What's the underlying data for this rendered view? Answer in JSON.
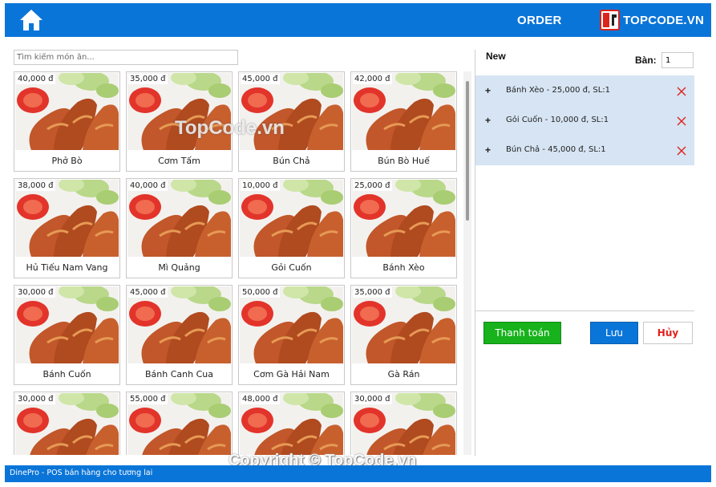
{
  "header": {
    "title": "ORDER",
    "logo_text": "TOPCODE.VN",
    "colors": {
      "bar": "#0a75d8",
      "logo_accent": "#d9251c"
    }
  },
  "search": {
    "placeholder": "Tìm kiếm món ăn..."
  },
  "menu": {
    "items": [
      {
        "name": "Phở Bò",
        "price": "40,000 đ"
      },
      {
        "name": "Cơm Tấm",
        "price": "35,000 đ"
      },
      {
        "name": "Bún Chả",
        "price": "45,000 đ"
      },
      {
        "name": "Bún Bò Huế",
        "price": "42,000 đ"
      },
      {
        "name": "Hủ Tiếu Nam Vang",
        "price": "38,000 đ"
      },
      {
        "name": "Mì Quảng",
        "price": "40,000 đ"
      },
      {
        "name": "Gỏi Cuốn",
        "price": "10,000 đ"
      },
      {
        "name": "Bánh Xèo",
        "price": "25,000 đ"
      },
      {
        "name": "Bánh Cuốn",
        "price": "30,000 đ"
      },
      {
        "name": "Bánh Canh Cua",
        "price": "45,000 đ"
      },
      {
        "name": "Cơm Gà Hải Nam",
        "price": "50,000 đ"
      },
      {
        "name": "Gà Rán",
        "price": "35,000 đ"
      },
      {
        "name": "",
        "price": "30,000 đ"
      },
      {
        "name": "",
        "price": "55,000 đ"
      },
      {
        "name": "",
        "price": "48,000 đ"
      },
      {
        "name": "",
        "price": "30,000 đ"
      }
    ]
  },
  "order": {
    "status": "New",
    "table_label": "Bàn:",
    "table_value": "1",
    "items": [
      {
        "text": "Bánh Xèo - 25,000 đ, SL:1"
      },
      {
        "text": "Gỏi Cuốn - 10,000 đ, SL:1"
      },
      {
        "text": "Bún Chả - 45,000 đ, SL:1"
      }
    ],
    "plus_label": "+",
    "pay_label": "Thanh toán",
    "save_label": "Lưu",
    "cancel_label": "Hủy",
    "colors": {
      "list_bg": "#d6e4f3",
      "pay": "#17b21c",
      "save": "#0a75d8",
      "cancel_text": "#e0201a"
    }
  },
  "watermark": "TopCode.vn",
  "footer": {
    "text": "DinePro - POS bán hàng cho tương lai",
    "copyright": "Copyright © TopCode.vn"
  }
}
